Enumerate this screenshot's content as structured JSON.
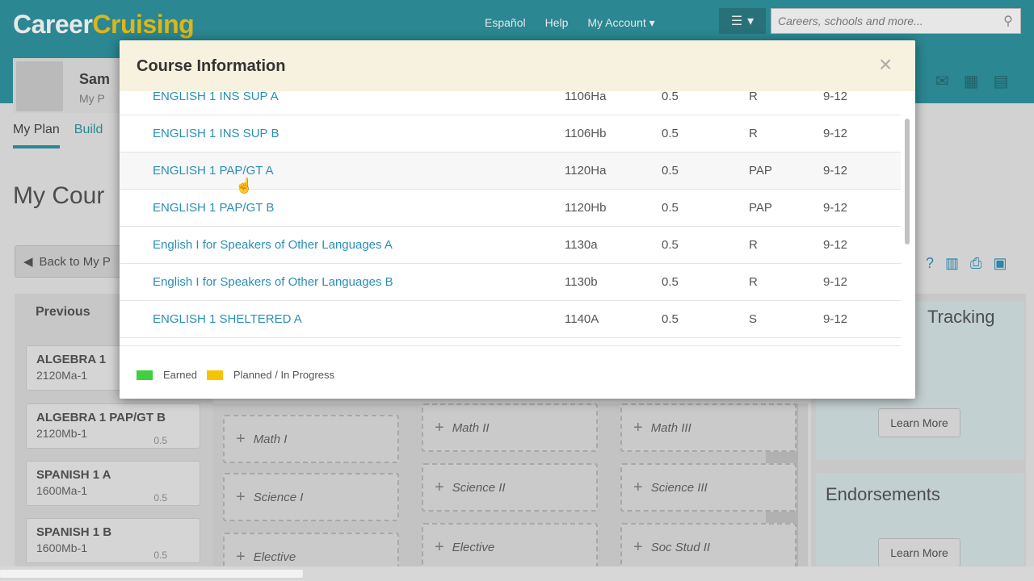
{
  "app": {
    "logo_part1": "Career",
    "logo_part2": "Cruising",
    "brand_color": "#1a8a96"
  },
  "header": {
    "links": [
      "Español",
      "Help",
      "My Account ▾"
    ],
    "search_placeholder": "Careers, schools and more..."
  },
  "profile": {
    "name": "Sam",
    "subtitle": "My P"
  },
  "nav": {
    "active_tab": "My Plan",
    "other_tab": "Build"
  },
  "page": {
    "title": "My Cour",
    "back_button": "Back to My P"
  },
  "previous": {
    "heading": "Previous",
    "courses": [
      {
        "name": "ALGEBRA 1",
        "code": "2120Ma-1",
        "credit": ""
      },
      {
        "name": "ALGEBRA 1 PAP/GT B",
        "code": "2120Mb-1",
        "credit": "0.5"
      },
      {
        "name": "SPANISH 1 A",
        "code": "1600Ma-1",
        "credit": "0.5"
      },
      {
        "name": "SPANISH 1 B",
        "code": "1600Mb-1",
        "credit": "0.5"
      }
    ]
  },
  "plan_slots": {
    "col1": [
      "Math I",
      "Science I",
      "Elective"
    ],
    "col2": [
      "Math II",
      "Science II",
      "Elective"
    ],
    "col3": [
      "Math III",
      "Science III",
      "Soc Stud II"
    ]
  },
  "sidebar": {
    "tracking_title": "Tracking",
    "endorsements_title": "Endorsements",
    "learn_more": "Learn More"
  },
  "modal": {
    "title": "Course Information",
    "close": "×",
    "courses": [
      {
        "name": "ENGLISH 1 INS SUP A",
        "code": "1106Ha",
        "credit": "0.5",
        "type": "R",
        "grades": "9-12"
      },
      {
        "name": "ENGLISH 1 INS SUP B",
        "code": "1106Hb",
        "credit": "0.5",
        "type": "R",
        "grades": "9-12"
      },
      {
        "name": "ENGLISH 1 PAP/GT A",
        "code": "1120Ha",
        "credit": "0.5",
        "type": "PAP",
        "grades": "9-12"
      },
      {
        "name": "ENGLISH 1 PAP/GT B",
        "code": "1120Hb",
        "credit": "0.5",
        "type": "PAP",
        "grades": "9-12"
      },
      {
        "name": "English I for Speakers of Other Languages A",
        "code": "1130a",
        "credit": "0.5",
        "type": "R",
        "grades": "9-12"
      },
      {
        "name": "English I for Speakers of Other Languages B",
        "code": "1130b",
        "credit": "0.5",
        "type": "R",
        "grades": "9-12"
      },
      {
        "name": "ENGLISH 1 SHELTERED A",
        "code": "1140A",
        "credit": "0.5",
        "type": "S",
        "grades": "9-12"
      }
    ],
    "legend": [
      {
        "label": "Earned",
        "color": "#3fcf3f"
      },
      {
        "label": "Planned / In Progress",
        "color": "#f5c400"
      }
    ]
  }
}
